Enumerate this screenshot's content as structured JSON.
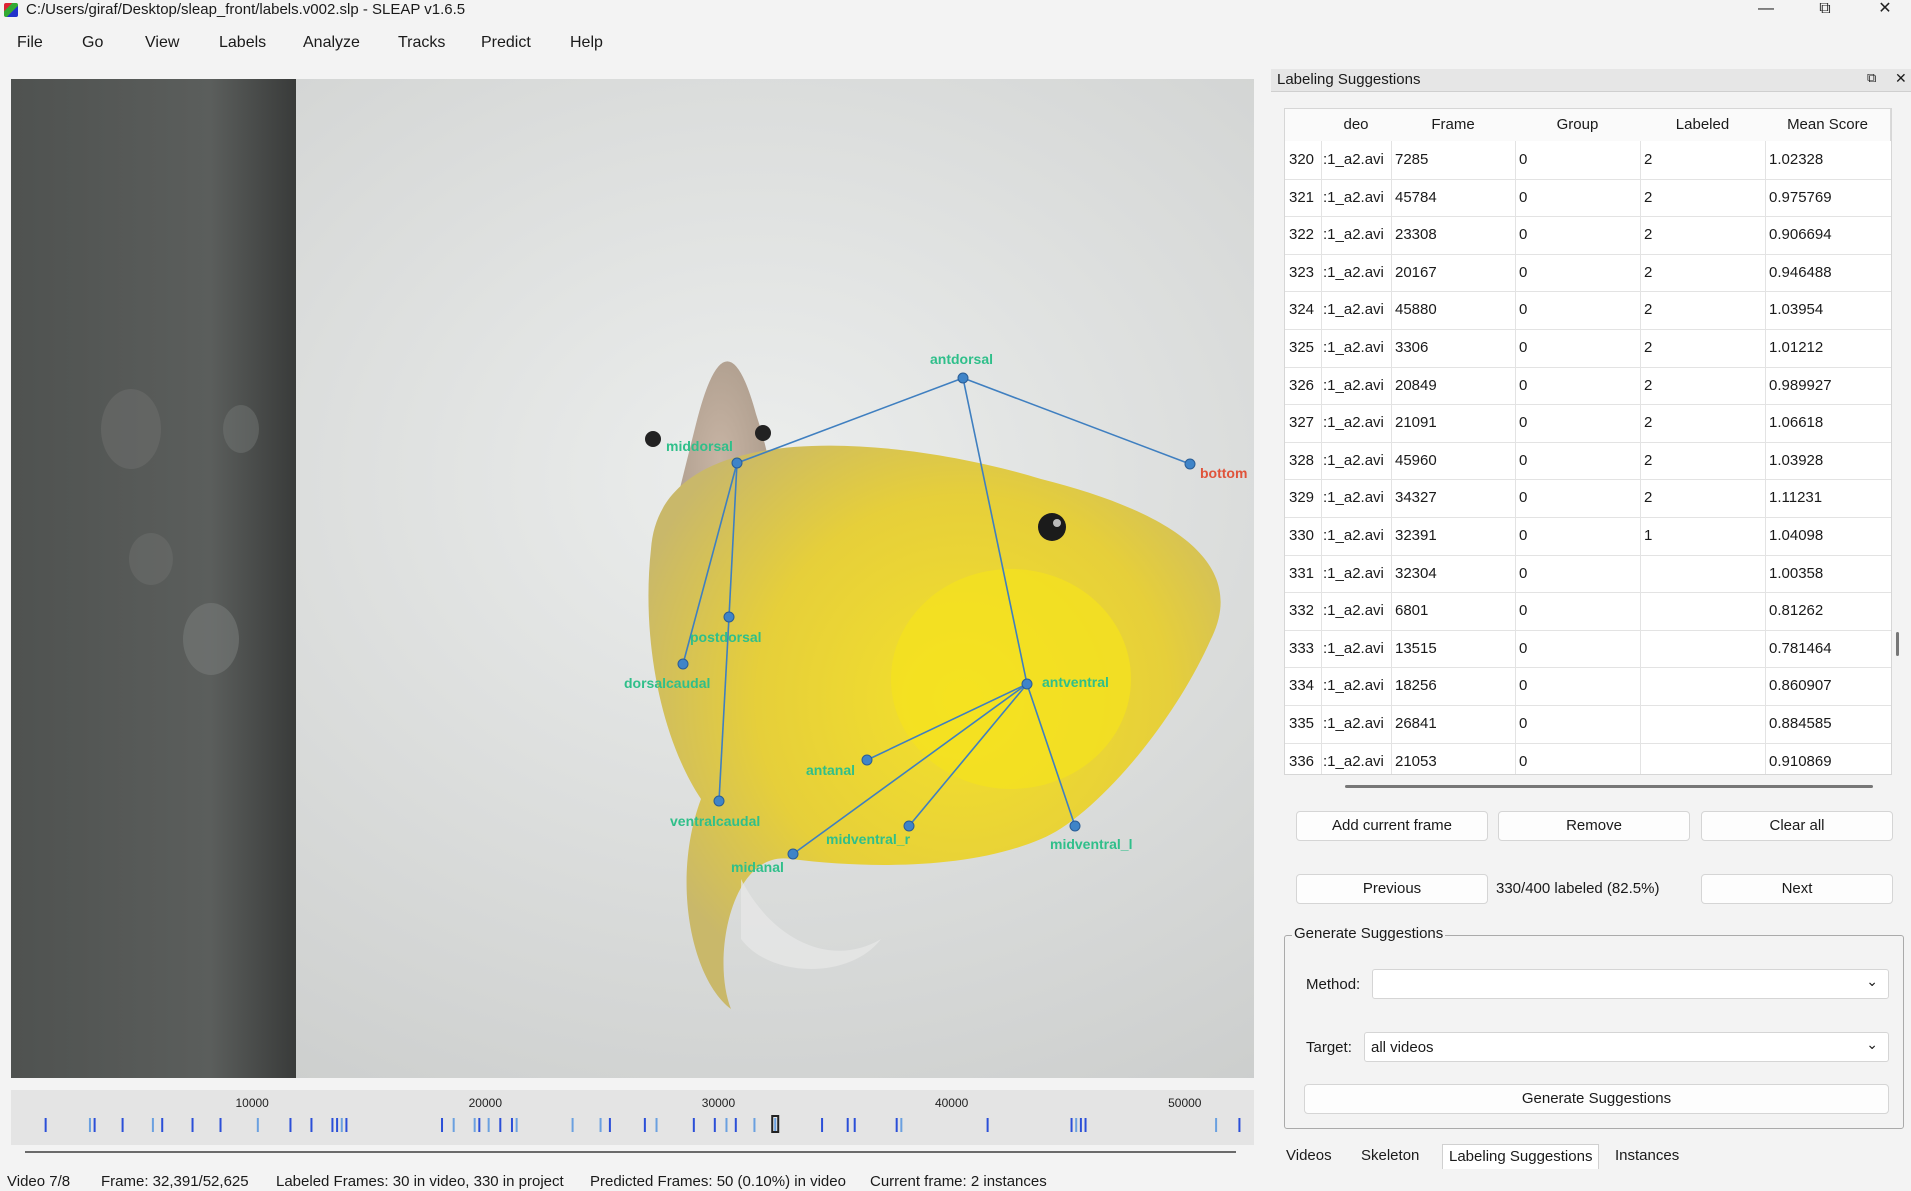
{
  "window": {
    "title": "C:/Users/giraf/Desktop/sleap_front/labels.v002.slp - SLEAP v1.6.5",
    "minimize": "—",
    "maximize": "⧉",
    "close": "✕"
  },
  "menubar": [
    "File",
    "Go",
    "View",
    "Labels",
    "Analyze",
    "Tracks",
    "Predict",
    "Help"
  ],
  "skeleton": {
    "node_color": "#3f84c8",
    "edge_color": "#3f7fc0",
    "label_color": "#2fbf8a",
    "highlight_label_color": "#e0533a",
    "nodes": [
      {
        "name": "antdorsal"
      },
      {
        "name": "middorsal"
      },
      {
        "name": "bottom"
      },
      {
        "name": "postdorsal"
      },
      {
        "name": "dorsalcaudal"
      },
      {
        "name": "antventral"
      },
      {
        "name": "antanal"
      },
      {
        "name": "ventralcaudal"
      },
      {
        "name": "midventral_r"
      },
      {
        "name": "midventral_l"
      },
      {
        "name": "midanal"
      }
    ]
  },
  "timeline": {
    "ticks": [
      "10000",
      "20000",
      "30000",
      "40000",
      "50000"
    ],
    "total_frames": 52625,
    "current_frame": 32391
  },
  "status": {
    "video": "Video 7/8",
    "frame": "Frame: 32,391/52,625",
    "labeled": "Labeled Frames: 30 in video, 330 in project",
    "predicted": "Predicted Frames: 50 (0.10%) in video",
    "current": "Current frame: 2 instances"
  },
  "dock": {
    "title": "Labeling Suggestions",
    "float_icon": "⧉",
    "close_icon": "✕",
    "columns": [
      "deo",
      "Frame",
      "Group",
      "Labeled",
      "Mean Score"
    ],
    "rows": [
      {
        "idx": "320",
        "video": ":1_a2.avi",
        "frame": "7285",
        "group": "0",
        "labeled": "2",
        "score": "1.02328"
      },
      {
        "idx": "321",
        "video": ":1_a2.avi",
        "frame": "45784",
        "group": "0",
        "labeled": "2",
        "score": "0.975769"
      },
      {
        "idx": "322",
        "video": ":1_a2.avi",
        "frame": "23308",
        "group": "0",
        "labeled": "2",
        "score": "0.906694"
      },
      {
        "idx": "323",
        "video": ":1_a2.avi",
        "frame": "20167",
        "group": "0",
        "labeled": "2",
        "score": "0.946488"
      },
      {
        "idx": "324",
        "video": ":1_a2.avi",
        "frame": "45880",
        "group": "0",
        "labeled": "2",
        "score": "1.03954"
      },
      {
        "idx": "325",
        "video": ":1_a2.avi",
        "frame": "3306",
        "group": "0",
        "labeled": "2",
        "score": "1.01212"
      },
      {
        "idx": "326",
        "video": ":1_a2.avi",
        "frame": "20849",
        "group": "0",
        "labeled": "2",
        "score": "0.989927"
      },
      {
        "idx": "327",
        "video": ":1_a2.avi",
        "frame": "21091",
        "group": "0",
        "labeled": "2",
        "score": "1.06618"
      },
      {
        "idx": "328",
        "video": ":1_a2.avi",
        "frame": "45960",
        "group": "0",
        "labeled": "2",
        "score": "1.03928"
      },
      {
        "idx": "329",
        "video": ":1_a2.avi",
        "frame": "34327",
        "group": "0",
        "labeled": "2",
        "score": "1.11231"
      },
      {
        "idx": "330",
        "video": ":1_a2.avi",
        "frame": "32391",
        "group": "0",
        "labeled": "1",
        "score": "1.04098"
      },
      {
        "idx": "331",
        "video": ":1_a2.avi",
        "frame": "32304",
        "group": "0",
        "labeled": "",
        "score": "1.00358"
      },
      {
        "idx": "332",
        "video": ":1_a2.avi",
        "frame": "6801",
        "group": "0",
        "labeled": "",
        "score": "0.81262"
      },
      {
        "idx": "333",
        "video": ":1_a2.avi",
        "frame": "13515",
        "group": "0",
        "labeled": "",
        "score": "0.781464"
      },
      {
        "idx": "334",
        "video": ":1_a2.avi",
        "frame": "18256",
        "group": "0",
        "labeled": "",
        "score": "0.860907"
      },
      {
        "idx": "335",
        "video": ":1_a2.avi",
        "frame": "26841",
        "group": "0",
        "labeled": "",
        "score": "0.884585"
      },
      {
        "idx": "336",
        "video": ":1_a2.avi",
        "frame": "21053",
        "group": "0",
        "labeled": "",
        "score": "0.910869"
      }
    ],
    "buttons": {
      "add": "Add current frame",
      "remove": "Remove",
      "clear": "Clear all",
      "previous": "Previous",
      "next": "Next"
    },
    "progress": "330/400 labeled (82.5%)",
    "generate": {
      "group_title": "Generate Suggestions",
      "method_label": "Method:",
      "method_value": "",
      "target_label": "Target:",
      "target_value": "all videos",
      "button": "Generate Suggestions"
    },
    "tabs": [
      "Videos",
      "Skeleton",
      "Labeling Suggestions",
      "Instances"
    ],
    "active_tab": "Labeling Suggestions"
  }
}
